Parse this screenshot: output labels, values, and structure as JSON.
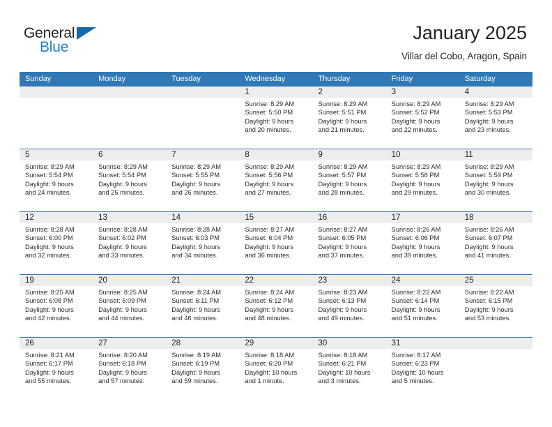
{
  "brand": {
    "name_part1": "General",
    "name_part2": "Blue",
    "triangle_icon": "triangle-icon",
    "accent_color": "#1f7fc4"
  },
  "header": {
    "title": "January 2025",
    "subtitle": "Villar del Cobo, Aragon, Spain"
  },
  "theme": {
    "header_blue": "#3079b5",
    "day_band_gray": "#ededed",
    "text_color": "#231f20"
  },
  "calendar": {
    "day_names": [
      "Sunday",
      "Monday",
      "Tuesday",
      "Wednesday",
      "Thursday",
      "Friday",
      "Saturday"
    ],
    "weeks": [
      [
        {
          "day": "",
          "lines": []
        },
        {
          "day": "",
          "lines": []
        },
        {
          "day": "",
          "lines": []
        },
        {
          "day": "1",
          "lines": [
            "Sunrise: 8:29 AM",
            "Sunset: 5:50 PM",
            "Daylight: 9 hours",
            "and 20 minutes."
          ]
        },
        {
          "day": "2",
          "lines": [
            "Sunrise: 8:29 AM",
            "Sunset: 5:51 PM",
            "Daylight: 9 hours",
            "and 21 minutes."
          ]
        },
        {
          "day": "3",
          "lines": [
            "Sunrise: 8:29 AM",
            "Sunset: 5:52 PM",
            "Daylight: 9 hours",
            "and 22 minutes."
          ]
        },
        {
          "day": "4",
          "lines": [
            "Sunrise: 8:29 AM",
            "Sunset: 5:53 PM",
            "Daylight: 9 hours",
            "and 23 minutes."
          ]
        }
      ],
      [
        {
          "day": "5",
          "lines": [
            "Sunrise: 8:29 AM",
            "Sunset: 5:54 PM",
            "Daylight: 9 hours",
            "and 24 minutes."
          ]
        },
        {
          "day": "6",
          "lines": [
            "Sunrise: 8:29 AM",
            "Sunset: 5:54 PM",
            "Daylight: 9 hours",
            "and 25 minutes."
          ]
        },
        {
          "day": "7",
          "lines": [
            "Sunrise: 8:29 AM",
            "Sunset: 5:55 PM",
            "Daylight: 9 hours",
            "and 26 minutes."
          ]
        },
        {
          "day": "8",
          "lines": [
            "Sunrise: 8:29 AM",
            "Sunset: 5:56 PM",
            "Daylight: 9 hours",
            "and 27 minutes."
          ]
        },
        {
          "day": "9",
          "lines": [
            "Sunrise: 8:29 AM",
            "Sunset: 5:57 PM",
            "Daylight: 9 hours",
            "and 28 minutes."
          ]
        },
        {
          "day": "10",
          "lines": [
            "Sunrise: 8:29 AM",
            "Sunset: 5:58 PM",
            "Daylight: 9 hours",
            "and 29 minutes."
          ]
        },
        {
          "day": "11",
          "lines": [
            "Sunrise: 8:29 AM",
            "Sunset: 5:59 PM",
            "Daylight: 9 hours",
            "and 30 minutes."
          ]
        }
      ],
      [
        {
          "day": "12",
          "lines": [
            "Sunrise: 8:28 AM",
            "Sunset: 6:00 PM",
            "Daylight: 9 hours",
            "and 32 minutes."
          ]
        },
        {
          "day": "13",
          "lines": [
            "Sunrise: 8:28 AM",
            "Sunset: 6:02 PM",
            "Daylight: 9 hours",
            "and 33 minutes."
          ]
        },
        {
          "day": "14",
          "lines": [
            "Sunrise: 8:28 AM",
            "Sunset: 6:03 PM",
            "Daylight: 9 hours",
            "and 34 minutes."
          ]
        },
        {
          "day": "15",
          "lines": [
            "Sunrise: 8:27 AM",
            "Sunset: 6:04 PM",
            "Daylight: 9 hours",
            "and 36 minutes."
          ]
        },
        {
          "day": "16",
          "lines": [
            "Sunrise: 8:27 AM",
            "Sunset: 6:05 PM",
            "Daylight: 9 hours",
            "and 37 minutes."
          ]
        },
        {
          "day": "17",
          "lines": [
            "Sunrise: 8:26 AM",
            "Sunset: 6:06 PM",
            "Daylight: 9 hours",
            "and 39 minutes."
          ]
        },
        {
          "day": "18",
          "lines": [
            "Sunrise: 8:26 AM",
            "Sunset: 6:07 PM",
            "Daylight: 9 hours",
            "and 41 minutes."
          ]
        }
      ],
      [
        {
          "day": "19",
          "lines": [
            "Sunrise: 8:25 AM",
            "Sunset: 6:08 PM",
            "Daylight: 9 hours",
            "and 42 minutes."
          ]
        },
        {
          "day": "20",
          "lines": [
            "Sunrise: 8:25 AM",
            "Sunset: 6:09 PM",
            "Daylight: 9 hours",
            "and 44 minutes."
          ]
        },
        {
          "day": "21",
          "lines": [
            "Sunrise: 8:24 AM",
            "Sunset: 6:11 PM",
            "Daylight: 9 hours",
            "and 46 minutes."
          ]
        },
        {
          "day": "22",
          "lines": [
            "Sunrise: 8:24 AM",
            "Sunset: 6:12 PM",
            "Daylight: 9 hours",
            "and 48 minutes."
          ]
        },
        {
          "day": "23",
          "lines": [
            "Sunrise: 8:23 AM",
            "Sunset: 6:13 PM",
            "Daylight: 9 hours",
            "and 49 minutes."
          ]
        },
        {
          "day": "24",
          "lines": [
            "Sunrise: 8:22 AM",
            "Sunset: 6:14 PM",
            "Daylight: 9 hours",
            "and 51 minutes."
          ]
        },
        {
          "day": "25",
          "lines": [
            "Sunrise: 8:22 AM",
            "Sunset: 6:15 PM",
            "Daylight: 9 hours",
            "and 53 minutes."
          ]
        }
      ],
      [
        {
          "day": "26",
          "lines": [
            "Sunrise: 8:21 AM",
            "Sunset: 6:17 PM",
            "Daylight: 9 hours",
            "and 55 minutes."
          ]
        },
        {
          "day": "27",
          "lines": [
            "Sunrise: 8:20 AM",
            "Sunset: 6:18 PM",
            "Daylight: 9 hours",
            "and 57 minutes."
          ]
        },
        {
          "day": "28",
          "lines": [
            "Sunrise: 8:19 AM",
            "Sunset: 6:19 PM",
            "Daylight: 9 hours",
            "and 59 minutes."
          ]
        },
        {
          "day": "29",
          "lines": [
            "Sunrise: 8:18 AM",
            "Sunset: 6:20 PM",
            "Daylight: 10 hours",
            "and 1 minute."
          ]
        },
        {
          "day": "30",
          "lines": [
            "Sunrise: 8:18 AM",
            "Sunset: 6:21 PM",
            "Daylight: 10 hours",
            "and 3 minutes."
          ]
        },
        {
          "day": "31",
          "lines": [
            "Sunrise: 8:17 AM",
            "Sunset: 6:23 PM",
            "Daylight: 10 hours",
            "and 5 minutes."
          ]
        },
        {
          "day": "",
          "lines": []
        }
      ]
    ]
  }
}
